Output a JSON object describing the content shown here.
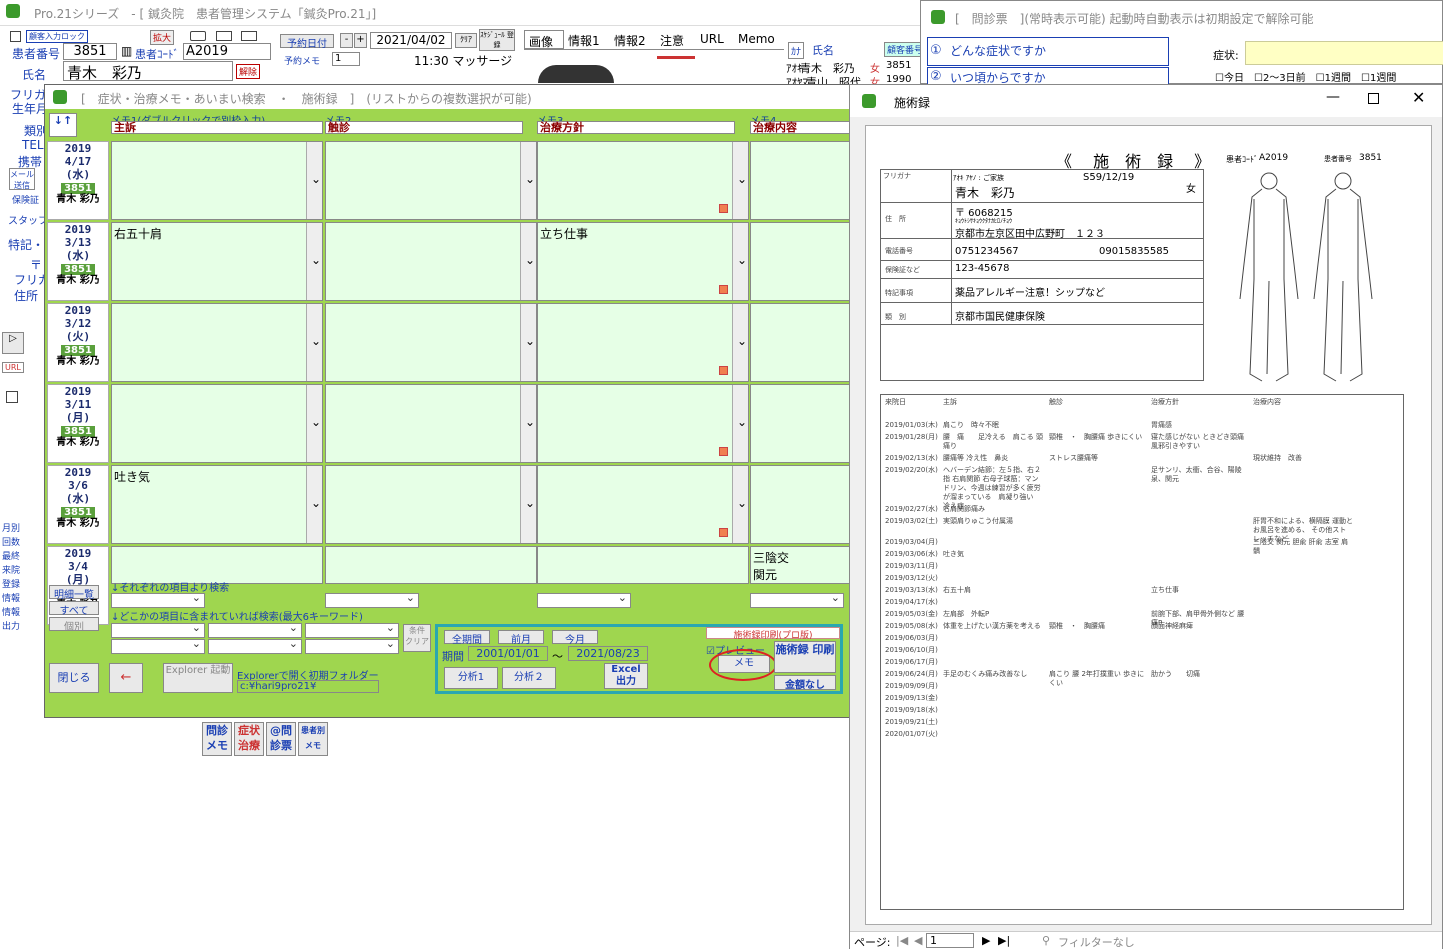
{
  "main": {
    "title": "Pro.21シリーズ　- [ 鍼灸院　患者管理システム「鍼灸Pro.21」]",
    "patient_no_label": "患者番号",
    "patient_no": "3851",
    "patient_code_label": "患者ｺｰﾄﾞ",
    "patient_code": "A2019",
    "name_label": "氏名",
    "name": "青木　彩乃",
    "release": "解除",
    "enlarge": "拡大",
    "lock": "顧客入力ロック",
    "reserve_label": "予約日付",
    "reserve_date": "2021/04/02",
    "clear": "ｸﾘｱ",
    "schedule": "ｽｹｼﾞｭｰﾙ 登録",
    "reserve_memo": "予約メモ",
    "memo_val": "1",
    "time_memo": "11:30 マッサージ",
    "tabs": [
      "画像",
      "情報1",
      "情報2",
      "注意",
      "URL",
      "Memo"
    ],
    "kana_label": "ｶﾅ",
    "list_name_label": "氏名",
    "list_no_label": "顧客番号",
    "list": [
      {
        "kana": "ｱｵｷ",
        "name": "青木　彩乃",
        "sex": "女",
        "no": "3851"
      },
      {
        "kana": "ｱｵﾔﾏ",
        "name": "青山　昭代",
        "sex": "女",
        "no": "1990"
      }
    ],
    "left_labels": [
      "フリガ",
      "生年月",
      "類別",
      "TEL",
      "携帯",
      "保険証",
      "スタッフ",
      "特記・重",
      "〒",
      "フリガ",
      "住所"
    ],
    "mail": "メール 送信",
    "url": "URL",
    "bottom_buttons": [
      "問診 メモ",
      "症状 治療",
      "@問 診票",
      "患者別 メモ"
    ],
    "side_buttons": [
      "月別",
      "回数",
      "最終",
      "来院",
      "登録",
      "情報",
      "情報",
      "出力"
    ]
  },
  "symptom_window": {
    "title": "[　症状・治療メモ・あいまい検索　・　施術録　]　(リストからの複数選択が可能)",
    "sort": "↓↑",
    "columns": [
      {
        "memo": "メモ1(ダブルクリックで別枠入力)",
        "label": "主訴"
      },
      {
        "memo": "メモ2",
        "label": "触診"
      },
      {
        "memo": "メモ3",
        "label": "治療方針"
      },
      {
        "memo": "メモ4",
        "label": "治療内容"
      }
    ],
    "rows": [
      {
        "year": "2019",
        "md": "4/17",
        "dow": "(水)",
        "no": "3851",
        "name": "青木 彩乃",
        "c1": "",
        "c2": "",
        "c3": "",
        "c4": ""
      },
      {
        "year": "2019",
        "md": "3/13",
        "dow": "(水)",
        "no": "3851",
        "name": "青木 彩乃",
        "c1": "右五十肩",
        "c2": "",
        "c3": "立ち仕事",
        "c4": ""
      },
      {
        "year": "2019",
        "md": "3/12",
        "dow": "(火)",
        "no": "3851",
        "name": "青木 彩乃",
        "c1": "",
        "c2": "",
        "c3": "",
        "c4": ""
      },
      {
        "year": "2019",
        "md": "3/11",
        "dow": "(月)",
        "no": "3851",
        "name": "青木 彩乃",
        "c1": "",
        "c2": "",
        "c3": "",
        "c4": ""
      },
      {
        "year": "2019",
        "md": "3/6",
        "dow": "(水)",
        "no": "3851",
        "name": "青木 彩乃",
        "c1": "吐き気",
        "c2": "",
        "c3": "",
        "c4": ""
      },
      {
        "year": "2019",
        "md": "3/4",
        "dow": "(月)",
        "no": "3851",
        "name": "青木 彩乃",
        "c1": "",
        "c2": "",
        "c3": "",
        "c4": "三陰交 関元"
      }
    ],
    "search_each": "↓それぞれの項目より検索",
    "search_any": "↓どこかの項目に含まれていれば検索(最大6キーワード)",
    "detail_list": "明細一覧",
    "all": "すべて",
    "individual": "個別",
    "cond_clear": "条件 クリア",
    "all_period": "全期間",
    "prev_month": "前月",
    "this_month": "今月",
    "period_label": "期間",
    "period_from": "2001/01/01",
    "tilde": "～",
    "period_to": "2021/08/23",
    "analysis1": "分析1",
    "analysis2": "分析２",
    "excel": "Excel 出力",
    "print_group": "施術録印刷(プロ版)",
    "preview": "プレビュー",
    "memo_btn": "メモ",
    "print_btn": "施術録 印刷",
    "no_amount": "金額なし",
    "close": "閉じる",
    "back": "←",
    "explorer": "Explorer 起動",
    "explorer_label": "Explorerで開く初期フォルダー",
    "folder": "c:¥hari9pro21¥"
  },
  "record_window": {
    "title": "施術録",
    "heading": "《　 施　術　録 　》",
    "code_label": "患者ｺｰﾄﾞ",
    "code": "A2019",
    "no_label": "患者番号",
    "no": "3851",
    "furigana_label": "フリガナ",
    "furigana": "ｱｵｷ ｱﾔﾉ : ご家族",
    "birth": "S59/12/19",
    "name": "青木　彩乃",
    "sex": "女",
    "addr_label": "住　所",
    "zip": "〒 6068215",
    "addr_kana": "ｷｮｳﾄｼｻｷｮｳｸﾀﾅｶﾋﾛﾉﾁｮｳ",
    "addr": "京都市左京区田中広野町　１２３",
    "tel_label": "電話番号",
    "tel": "0751234567",
    "mobile": "09015835585",
    "ins_label": "保険証など",
    "ins": "123-45678",
    "note_label": "特記事項",
    "note": "薬品アレルギー注意！シップなど",
    "type_label": "類　別",
    "type": "京都市国民健康保険",
    "hist_headers": [
      "来院日",
      "主訴",
      "触診",
      "治療方針",
      "治療内容"
    ],
    "history": [
      {
        "d": "2019/01/03(木)",
        "a": "肩こり　時々不眠",
        "b": "",
        "c": "胃痛感",
        "e": ""
      },
      {
        "d": "2019/01/28(月)",
        "a": "腰　痛　　足冷える　肩こる 頭痛り",
        "b": "頸椎　・　胸腰痛 歩きにくい",
        "c": "寝た感じがない ときどき頭痛 風邪引きやすい",
        "e": ""
      },
      {
        "d": "2019/02/13(水)",
        "a": "腰痛等 冷え性　鼻炎",
        "b": "ストレス腰痛等",
        "c": "",
        "e": "現状維持　改善"
      },
      {
        "d": "2019/02/20(水)",
        "a": "ヘバーデン結節：左５指、右２指 右肩関節 右母子球筋：マンドリン、今週は練習が多く疲労が溜まっている　肩凝り強い　冷え症",
        "b": "",
        "c": "足サンリ、太衝、合谷、陽陵泉、関元",
        "e": ""
      },
      {
        "d": "2019/02/27(水)",
        "a": "右肩関節痛み",
        "b": "",
        "c": "",
        "e": ""
      },
      {
        "d": "2019/03/02(土)",
        "a": "実頭肩りゅこう付属湯",
        "b": "",
        "c": "",
        "e": "肝胃不和による、横隔膜 運動とお風呂を進める、 その他ストレッチなど"
      },
      {
        "d": "2019/03/04(月)",
        "a": "",
        "b": "",
        "c": "",
        "e": "三陰交 関元 胆兪 肝兪 志室 肩髃"
      },
      {
        "d": "2019/03/06(水)",
        "a": "吐き気",
        "b": "",
        "c": "",
        "e": ""
      },
      {
        "d": "2019/03/11(月)",
        "a": "",
        "b": "",
        "c": "",
        "e": ""
      },
      {
        "d": "2019/03/12(火)",
        "a": "",
        "b": "",
        "c": "",
        "e": ""
      },
      {
        "d": "2019/03/13(水)",
        "a": "右五十肩",
        "b": "",
        "c": "立ち仕事",
        "e": ""
      },
      {
        "d": "2019/04/17(水)",
        "a": "",
        "b": "",
        "c": "",
        "e": ""
      },
      {
        "d": "2019/05/03(金)",
        "a": "左肩部　外転P",
        "b": "",
        "c": "前腕下部、肩甲骨外側など 腰痛P",
        "e": ""
      },
      {
        "d": "2019/05/08(水)",
        "a": "体重を上げたい漢方薬を考える",
        "b": "頸椎　・　胸腰痛",
        "c": "顔面神経麻痺",
        "e": ""
      },
      {
        "d": "2019/06/03(月)",
        "a": "",
        "b": "",
        "c": "",
        "e": ""
      },
      {
        "d": "2019/06/10(月)",
        "a": "",
        "b": "",
        "c": "",
        "e": ""
      },
      {
        "d": "2019/06/17(月)",
        "a": "",
        "b": "",
        "c": "",
        "e": ""
      },
      {
        "d": "2019/06/24(月)",
        "a": "手足のむくみ痛み改善なし",
        "b": "肩こり 腰 2年打撲重い 歩きにくい",
        "c": "肋かう　　切痛",
        "e": ""
      },
      {
        "d": "2019/09/09(月)",
        "a": "",
        "b": "",
        "c": "",
        "e": ""
      },
      {
        "d": "2019/09/13(金)",
        "a": "",
        "b": "",
        "c": "",
        "e": ""
      },
      {
        "d": "2019/09/18(水)",
        "a": "",
        "b": "",
        "c": "",
        "e": ""
      },
      {
        "d": "2019/09/21(土)",
        "a": "",
        "b": "",
        "c": "",
        "e": ""
      },
      {
        "d": "2020/01/07(火)",
        "a": "",
        "b": "",
        "c": "",
        "e": ""
      }
    ],
    "page_label": "ページ:",
    "page": "1",
    "filter": "フィルターなし"
  },
  "question_window": {
    "title": "[　問診票　](常時表示可能) 起動時自動表示は初期設定で解除可能",
    "q1_no": "①",
    "q1": "どんな症状ですか",
    "q2_no": "②",
    "q2": "いつ頃からですか",
    "symptom_label": "症状:",
    "opts": [
      "今日",
      "2～3日前",
      "1週間",
      "1週間"
    ]
  }
}
